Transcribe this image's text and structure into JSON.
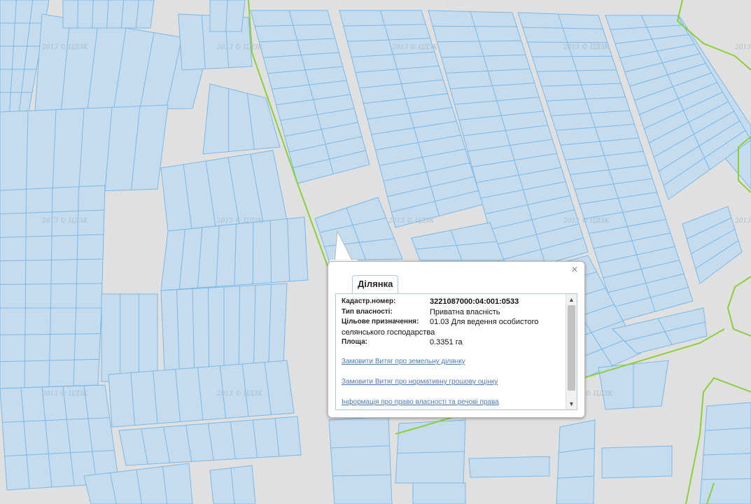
{
  "map": {
    "watermark": "2013 © ЦДЗК",
    "colors": {
      "background": "#e0e0e0",
      "parcel_fill": "#c5dcee",
      "parcel_stroke": "#7ab8e8",
      "boundary": "#8ccf3c"
    }
  },
  "popup": {
    "tab_label": "Ділянка",
    "close_label": "×",
    "fields": [
      {
        "label": "Кадастр.номер:",
        "value": "3221087000:04:001:0533"
      },
      {
        "label": "Тип власності:",
        "value": "Приватна власність"
      },
      {
        "label": "Цільове призначення:",
        "value": "01.03 Для ведення особистого"
      },
      {
        "label": "Площа:",
        "value": "0.3351 га"
      }
    ],
    "purpose_wrap": "селянського господарства",
    "links": [
      "Замовити Витяг про земельну ділянку",
      "Замовити Витяг про нормативну грошову оцінку",
      "Інформація про право власності та речові права"
    ],
    "scroll_up": "▲",
    "scroll_down": "▼"
  }
}
